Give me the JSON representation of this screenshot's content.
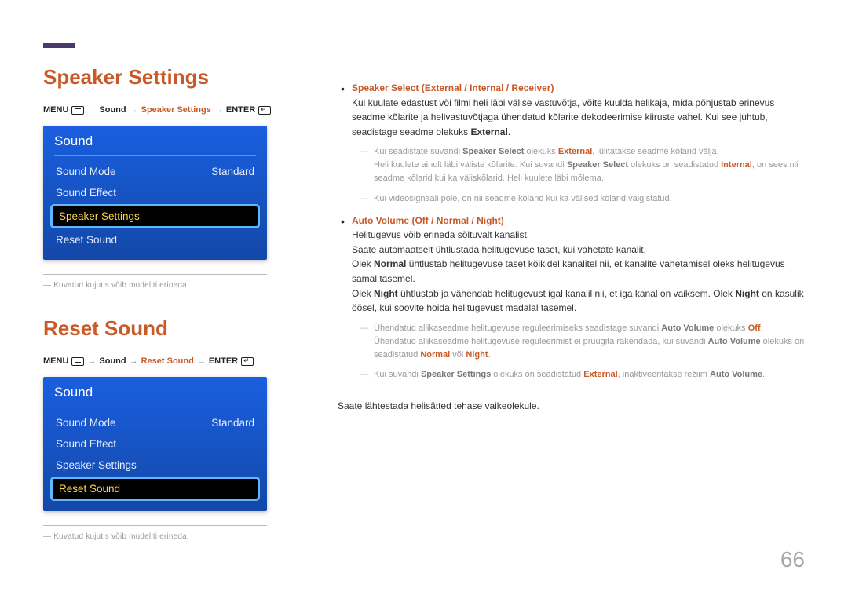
{
  "headings": {
    "speaker_settings": "Speaker Settings",
    "reset_sound": "Reset Sound"
  },
  "nav": {
    "menu": "MENU",
    "sound": "Sound",
    "speaker_settings": "Speaker Settings",
    "reset_sound": "Reset Sound",
    "enter": "ENTER"
  },
  "osd": {
    "title": "Sound",
    "rows": {
      "sound_mode": "Sound Mode",
      "standard": "Standard",
      "sound_effect": "Sound Effect",
      "speaker_settings": "Speaker Settings",
      "reset_sound": "Reset Sound"
    }
  },
  "footnote": "Kuvatud kujutis võib mudeliti erineda.",
  "right": {
    "speaker_head": "Speaker Select (External / Internal / Receiver)",
    "speaker_body1": "Kui kuulate edastust või filmi heli läbi välise vastuvõtja, võite kuulda helikaja, mida põhjustab erinevus seadme kõlarite ja helivastuvõtjaga ühendatud kõlarite dekodeerimise kiiruste vahel. Kui see juhtub, seadistage seadme olekuks ",
    "external": "External",
    "dash1a": "Kui seadistate suvandi ",
    "dash1b": " olekuks ",
    "dash1c": ", lülitatakse seadme kõlarid välja.",
    "dash1d": "Heli kuulete ainult läbi väliste kõlarite. Kui suvandi ",
    "dash1e": " olekuks on seadistatud ",
    "internal": "Internal",
    "dash1f": ", on sees nii seadme kõlarid kui ka väliskõlarid. Heli kuulete läbi mõlema.",
    "dash2": "Kui videosignaali pole, on nii seadme kõlarid kui ka välised kõlarid vaigistatud.",
    "auto_head": "Auto Volume (Off / Normal / Night)",
    "auto_body1": "Helitugevus võib erineda sõltuvalt kanalist.",
    "auto_body2": "Saate automaatselt ühtlustada helitugevuse taset, kui vahetate kanalit.",
    "auto_body3a": "Olek ",
    "normal": "Normal",
    "auto_body3b": " ühtlustab helitugevuse taset kõikidel kanalitel nii, et kanalite vahetamisel oleks helitugevus samal tasemel.",
    "auto_body4a": "Olek ",
    "night": "Night",
    "auto_body4b": " ühtlustab ja vähendab helitugevust igal kanalil nii, et iga kanal on vaiksem. Olek ",
    "auto_body4c": " on kasulik öösel, kui soovite hoida helitugevust madalal tasemel.",
    "dash3a": "Ühendatud allikaseadme helitugevuse reguleerimiseks seadistage suvandi ",
    "auto_volume": "Auto Volume",
    "dash3b": " olekuks ",
    "off": "Off",
    "dash3c": ". Ühendatud allikaseadme helitugevuse reguleerimist ei pruugita rakendada, kui suvandi ",
    "dash3d": " olekuks on seadistatud ",
    "dash3e": " või ",
    "dash4a": "Kui suvandi ",
    "speaker_settings": "Speaker Settings",
    "dash4b": " olekuks on seadistatud ",
    "dash4c": ", inaktiveeritakse režiim ",
    "reset_body": "Saate lähtestada helisätted tehase vaikeolekule."
  },
  "page_number": "66"
}
